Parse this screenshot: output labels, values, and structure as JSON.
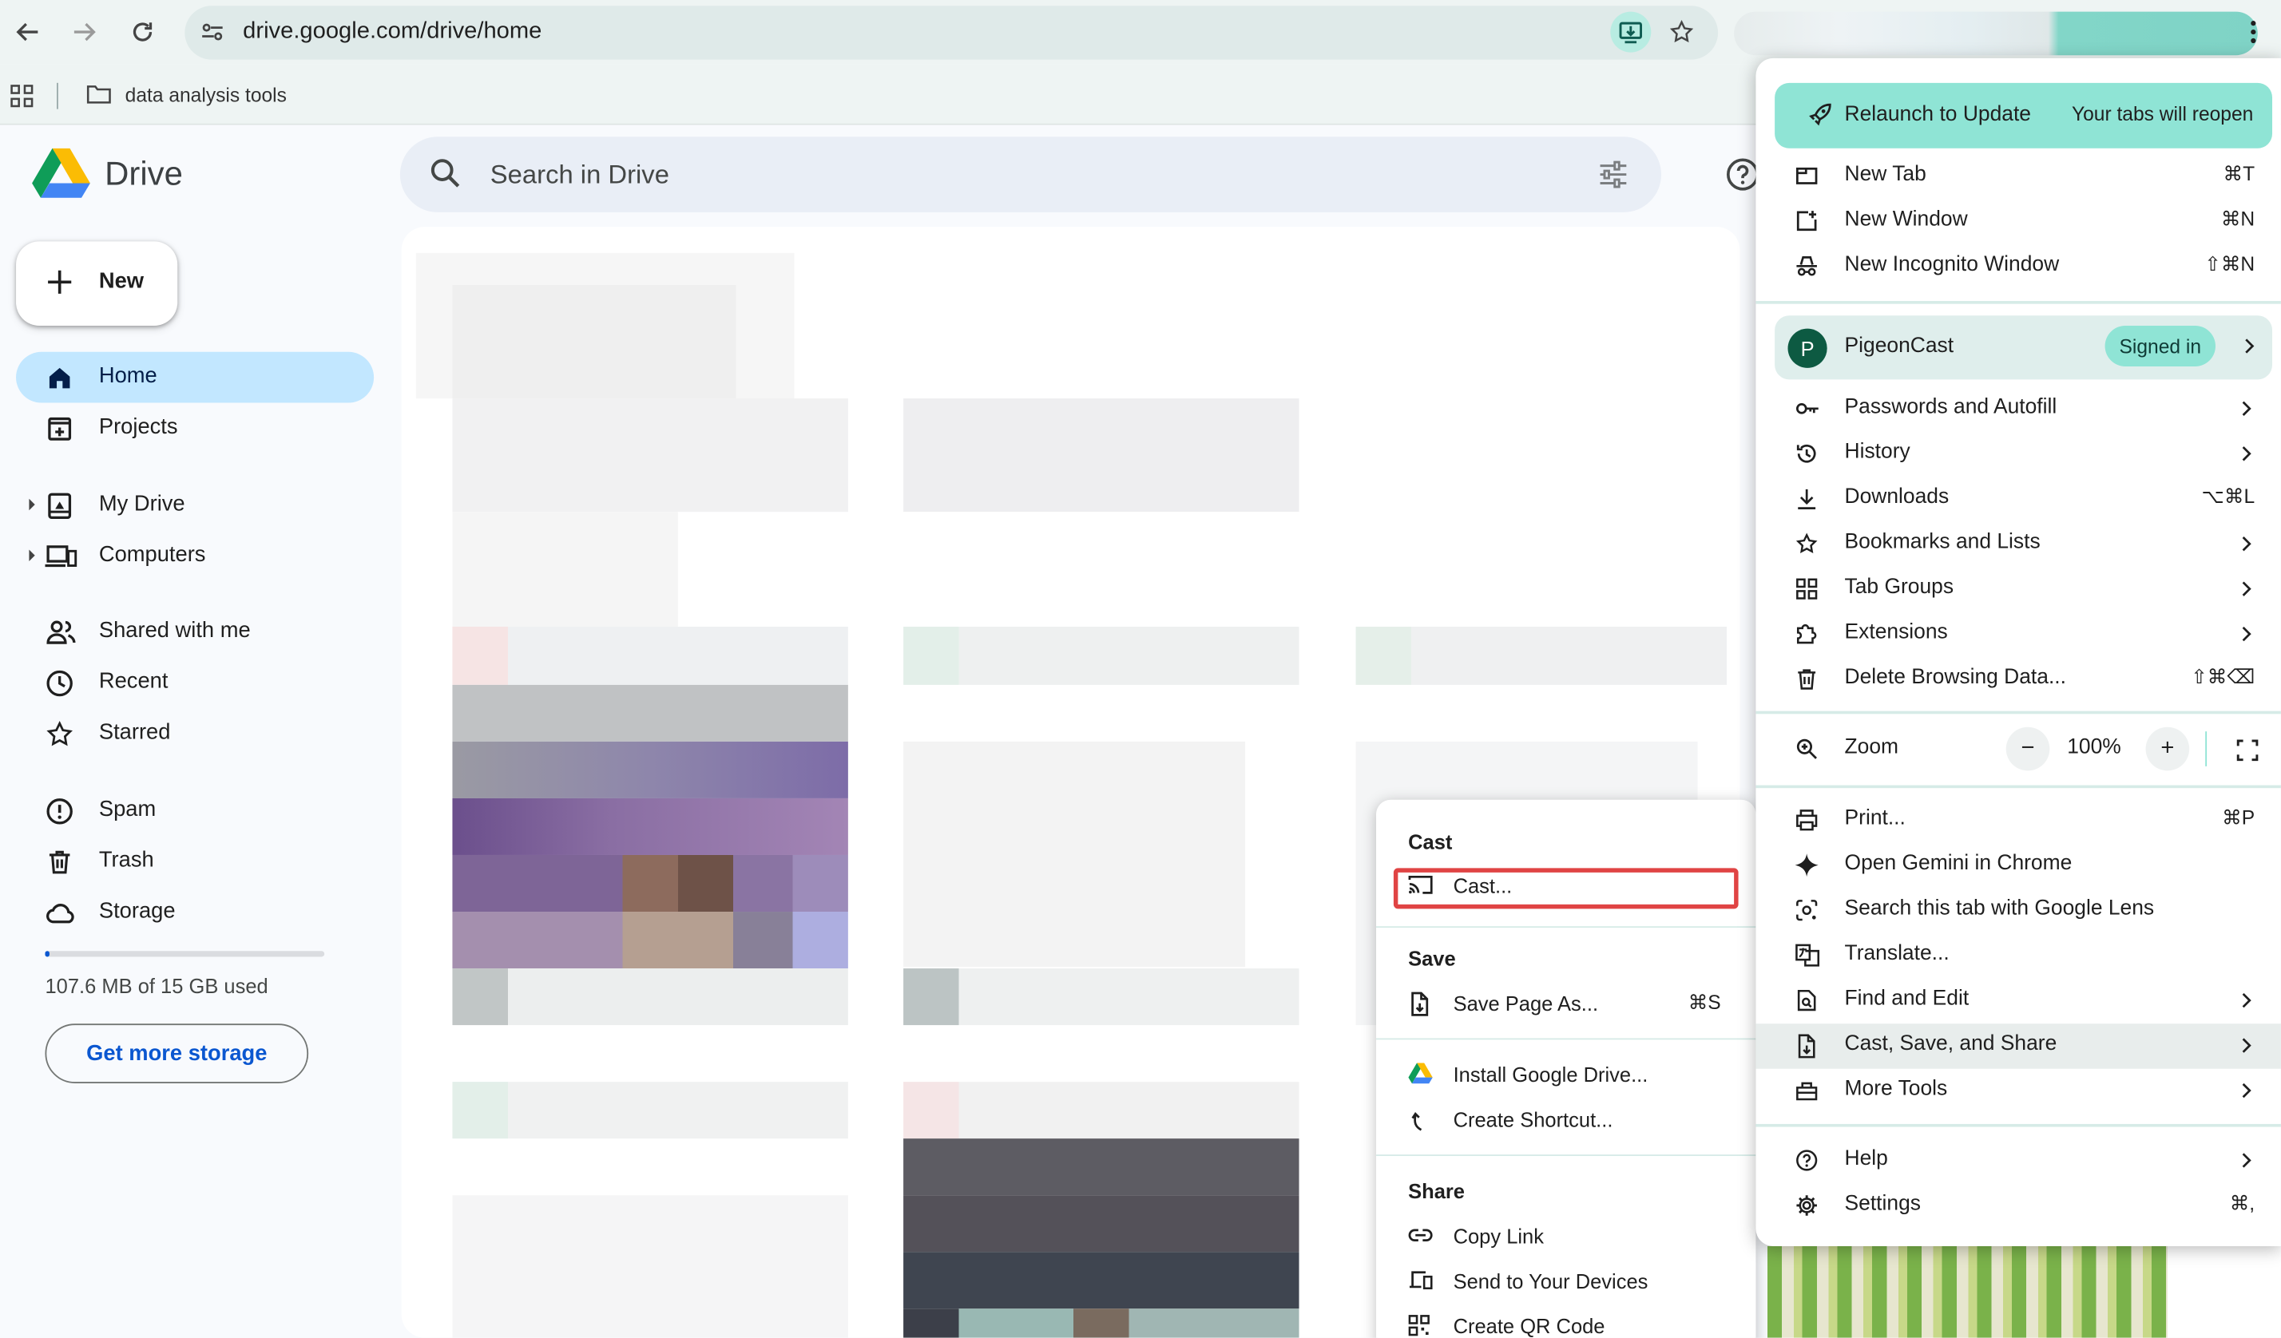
{
  "browser": {
    "url": "drive.google.com/drive/home",
    "bookmark_folder": "data analysis tools"
  },
  "drive": {
    "app_title": "Drive",
    "search_placeholder": "Search in Drive",
    "new_label": "New",
    "nav": [
      {
        "label": "Home",
        "icon": "home-icon",
        "active": true
      },
      {
        "label": "Projects",
        "icon": "projects-icon"
      },
      {
        "label": "My Drive",
        "icon": "my-drive-icon"
      },
      {
        "label": "Computers",
        "icon": "computers-icon"
      },
      {
        "label": "Shared with me",
        "icon": "shared-icon"
      },
      {
        "label": "Recent",
        "icon": "recent-icon"
      },
      {
        "label": "Starred",
        "icon": "star-icon"
      },
      {
        "label": "Spam",
        "icon": "spam-icon"
      },
      {
        "label": "Trash",
        "icon": "trash-icon"
      },
      {
        "label": "Storage",
        "icon": "cloud-icon"
      }
    ],
    "storage_used_text": "107.6 MB of 15 GB used",
    "storage_used_fraction": 0.007,
    "get_storage_label": "Get more storage"
  },
  "submenu": {
    "cast_heading": "Cast",
    "cast_item": "Cast...",
    "save_heading": "Save",
    "save_page": "Save Page As...",
    "save_page_shortcut": "⌘S",
    "install": "Install Google Drive...",
    "create_shortcut": "Create Shortcut...",
    "share_heading": "Share",
    "copy_link": "Copy Link",
    "send_devices": "Send to Your Devices",
    "qr_code": "Create QR Code"
  },
  "menu": {
    "relaunch": "Relaunch to Update",
    "relaunch_sub": "Your tabs will reopen",
    "new_tab": "New Tab",
    "new_tab_sc": "⌘T",
    "new_window": "New Window",
    "new_window_sc": "⌘N",
    "incognito": "New Incognito Window",
    "incognito_sc": "⇧⌘N",
    "profile_initial": "P",
    "profile_name": "PigeonCast",
    "signed_in": "Signed in",
    "passwords": "Passwords and Autofill",
    "history": "History",
    "downloads": "Downloads",
    "downloads_sc": "⌥⌘L",
    "bookmarks": "Bookmarks and Lists",
    "tab_groups": "Tab Groups",
    "extensions": "Extensions",
    "delete_data": "Delete Browsing Data...",
    "delete_data_sc": "⇧⌘⌫",
    "zoom": "Zoom",
    "zoom_minus": "−",
    "zoom_value": "100%",
    "zoom_plus": "+",
    "print": "Print...",
    "print_sc": "⌘P",
    "gemini": "Open Gemini in Chrome",
    "lens": "Search this tab with Google Lens",
    "translate": "Translate...",
    "find_edit": "Find and Edit",
    "cast_save_share": "Cast, Save, and Share",
    "more_tools": "More Tools",
    "help": "Help",
    "settings": "Settings",
    "settings_sc": "⌘,"
  },
  "colors": {
    "accent": "#8fe4d5",
    "drive_blue": "#0b57d0",
    "nav_active": "#c2e7ff",
    "highlight_red": "#e04444"
  }
}
